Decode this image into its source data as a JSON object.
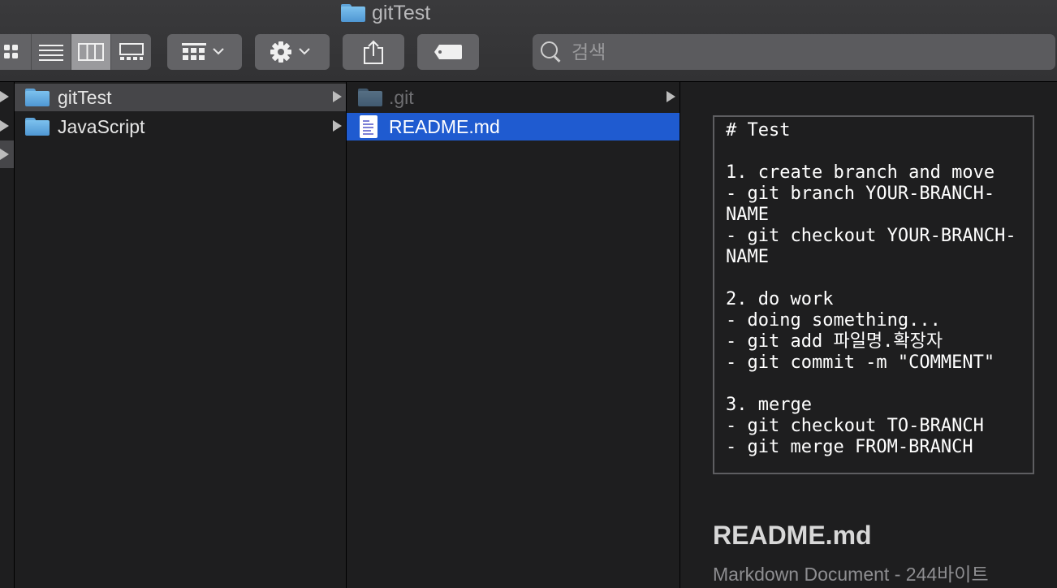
{
  "window": {
    "title": "gitTest"
  },
  "toolbar": {
    "view_buttons": [
      "icon-view",
      "list-view",
      "column-view",
      "gallery-view"
    ],
    "active_view": "column-view",
    "search_placeholder": "검색"
  },
  "columns": {
    "col1": [
      {
        "label": "gitTest",
        "selected": true,
        "has_children": true
      },
      {
        "label": "JavaScript",
        "selected": false,
        "has_children": true
      }
    ],
    "col2": [
      {
        "label": ".git",
        "hidden": true,
        "has_children": true
      },
      {
        "label": "README.md",
        "selected": true,
        "has_children": false
      }
    ]
  },
  "preview": {
    "content": "# Test\n\n1. create branch and move\n- git branch YOUR-BRANCH-\nNAME\n- git checkout YOUR-BRANCH-\nNAME\n\n2. do work\n- doing something...\n- git add 파일명.확장자\n- git commit -m \"COMMENT\"\n\n3. merge\n- git checkout TO-BRANCH\n- git merge FROM-BRANCH",
    "file_name": "README.md",
    "file_info": "Markdown Document - 244바이트"
  },
  "colors": {
    "selection_blue": "#1f5bd0",
    "selection_gray": "#464649",
    "folder_blue": "#6db4e6",
    "background": "#1e1e1f"
  }
}
